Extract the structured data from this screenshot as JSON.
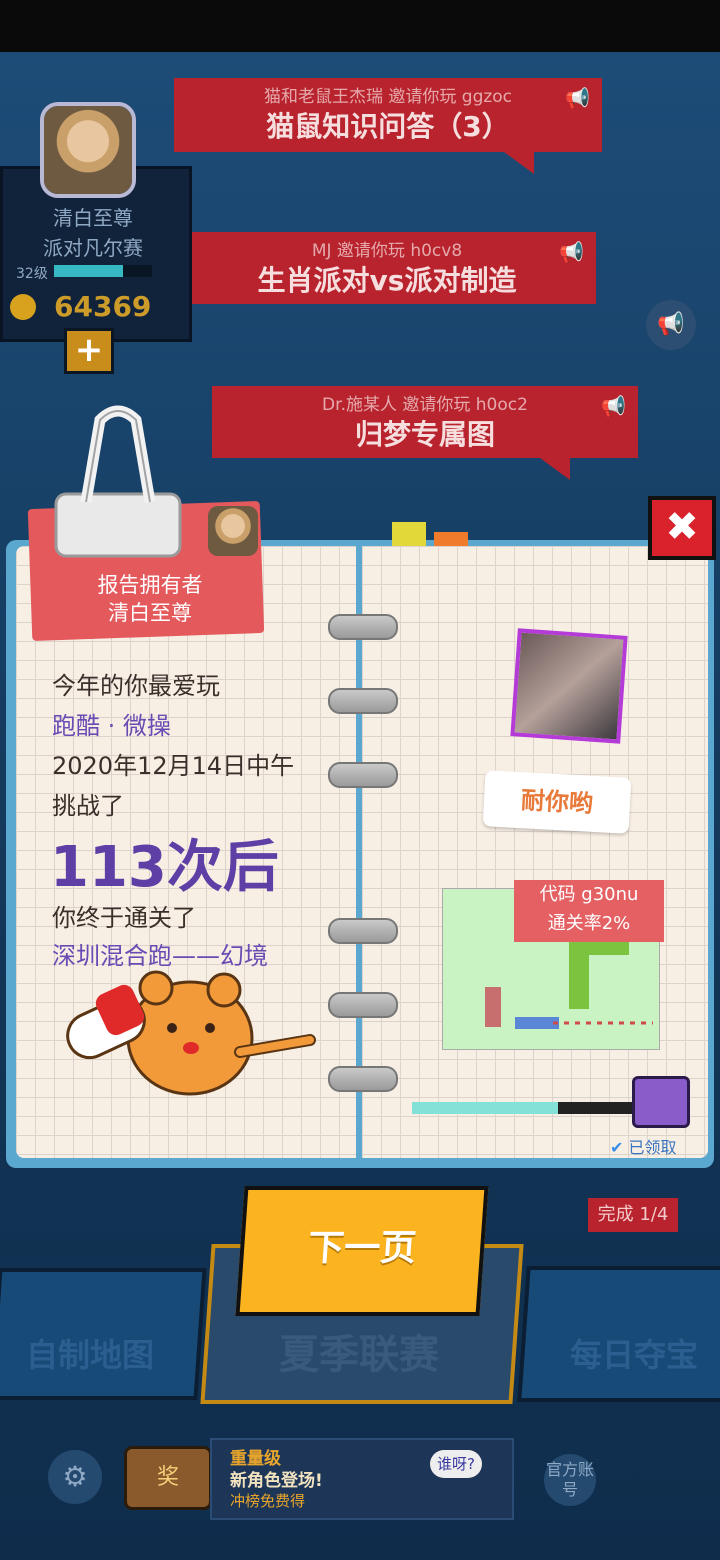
{
  "invites": [
    {
      "line": "猫和老鼠王杰瑞 邀请你玩 ggzoc",
      "map": "猫鼠知识问答（3）"
    },
    {
      "line": "MJ 邀请你玩 h0cv8",
      "map": "生肖派对vs派对制造"
    },
    {
      "line": "Dr.施某人 邀请你玩 h0oc2",
      "map": "归梦专属图"
    }
  ],
  "profile": {
    "name": "清白至尊",
    "title": "派对凡尔赛",
    "level": "32级",
    "coins": "64369",
    "level_progress": 0.7
  },
  "report": {
    "tag_line1": "报告拥有者",
    "tag_line2": "清白至尊",
    "line1": "今年的你最爱玩",
    "genres": "跑酷 · 微操",
    "date": "2020年12月14日中午",
    "line_challenge": "挑战了",
    "attempts": "113次后",
    "line_cleared": "你终于通关了",
    "map_name": "深圳混合跑——幻境",
    "author_comment": "耐你哟",
    "map_code": "代码 g30nu",
    "clear_rate": "通关率2%",
    "progress": 0.64,
    "claimed": "已领取"
  },
  "buttons": {
    "next": "下一页",
    "close": "✖",
    "plus": "+"
  },
  "bottom": {
    "custom_map": "自制地图",
    "summer_league": "夏季联赛",
    "daily_treasure": "每日夺宝",
    "done": "完成 1/4",
    "official": "官方账号"
  },
  "ad": {
    "tag": "奖",
    "line1": "重量级",
    "line2": "新角色登场!",
    "line3": "冲榜免费得",
    "bubble": "谁呀?"
  },
  "icons": {
    "megaphone": "📢",
    "gear": "⚙",
    "check": "✔"
  }
}
